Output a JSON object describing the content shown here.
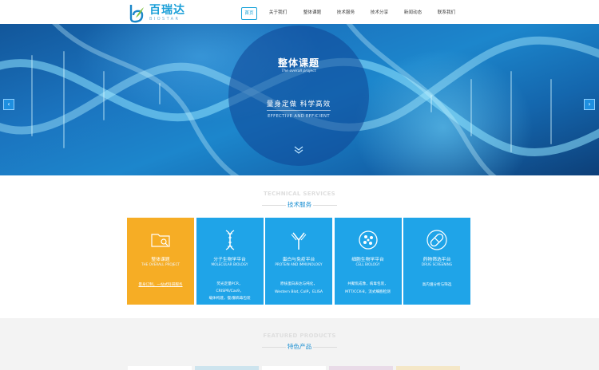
{
  "header": {
    "logo_cn": "百瑞达",
    "logo_en": "BIOSTAR",
    "nav": [
      {
        "label": "首页",
        "active": true
      },
      {
        "label": "关于我们",
        "active": false
      },
      {
        "label": "整体课题",
        "active": false
      },
      {
        "label": "技术服务",
        "active": false
      },
      {
        "label": "技术分享",
        "active": false
      },
      {
        "label": "新闻动态",
        "active": false
      },
      {
        "label": "联系我们",
        "active": false
      }
    ]
  },
  "banner": {
    "title": "整体课题",
    "subtitle": "The overall project",
    "slogan": "量身定做   科学高效",
    "slogan_en": "EFFECTIVE AND EFFICIENT",
    "prev_icon": "chevron-left-icon",
    "next_icon": "chevron-right-icon",
    "prev_glyph": "‹",
    "next_glyph": "›"
  },
  "services": {
    "title_en": "TECHNICAL SERVICES",
    "title_cn": "技术服务",
    "cards": [
      {
        "icon": "folder-search-icon",
        "title": "整体课题",
        "en": "THE OVERALL PROJECT",
        "lines": [
          "量身订制，一站式科研服务"
        ],
        "color": "#f6ad25"
      },
      {
        "icon": "dna-icon",
        "title": "分子生物学平台",
        "en": "MOLECULAR BIOLOGY",
        "lines": [
          "荧光定量PCR，",
          "CRISPR/Cas9，",
          "载体构建，慢/腺病毒包装"
        ],
        "color": "#1fa4e8"
      },
      {
        "icon": "antibody-icon",
        "title": "蛋白与免疫平台",
        "en": "PROTEIN AND IMMUNOLOGY",
        "lines": [
          "原核蛋白表达与纯化，",
          "Western Blot, CoIP，ELISA"
        ],
        "color": "#1fa4e8"
      },
      {
        "icon": "cell-icon",
        "title": "细胞生物学平台",
        "en": "CELL BIOLOGY",
        "lines": [
          "共聚焦成像，病毒包装，",
          "MTT/CCK-8，流式细胞检测"
        ],
        "color": "#1fa4e8"
      },
      {
        "icon": "capsule-icon",
        "title": "药物筛选平台",
        "en": "DRUG SCREENING",
        "lines": [
          "高内涵分析与筛选"
        ],
        "color": "#1fa4e8"
      }
    ]
  },
  "featured": {
    "title_en": "FEATURED PRODUCTS",
    "title_cn": "特色产品"
  },
  "colors": {
    "accent": "#1aa3d9",
    "card_blue": "#1fa4e8",
    "card_orange": "#f6ad25"
  }
}
